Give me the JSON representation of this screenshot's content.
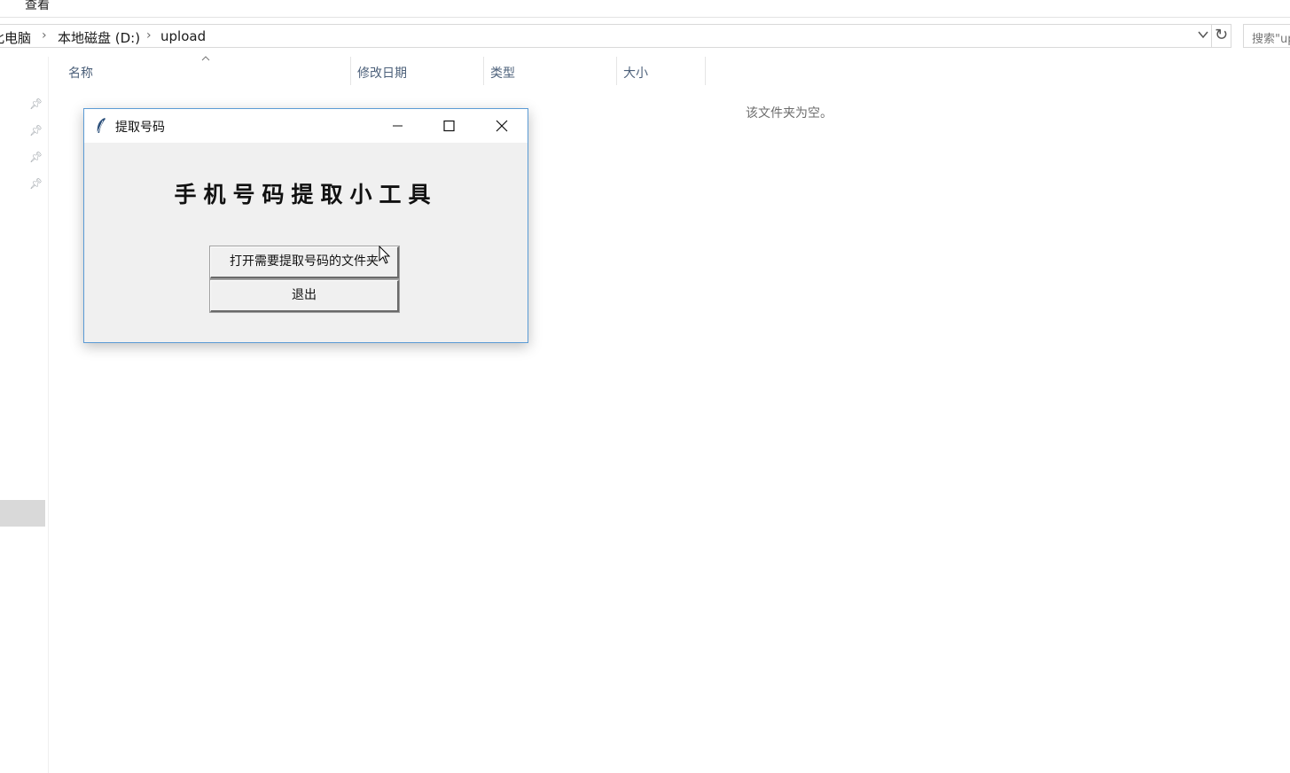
{
  "explorer": {
    "menu": {
      "view": "查看"
    },
    "breadcrumb": [
      "此电脑",
      "本地磁盘 (D:)",
      "upload"
    ],
    "search": {
      "placeholder": "搜索\"upload\""
    },
    "columns": [
      "名称",
      "修改日期",
      "类型",
      "大小"
    ],
    "empty_message": "该文件夹为空。"
  },
  "dialog": {
    "title": "提取号码",
    "heading": "手机号码提取小工具",
    "open_button": "打开需要提取号码的文件夹",
    "exit_button": "退出"
  },
  "icons": {
    "dropdown": "chevron-down-icon",
    "refresh": "refresh-icon",
    "pin": "pin-icon",
    "app": "feather-icon"
  },
  "colors": {
    "dialog_border": "#5b9bd5",
    "dialog_bg": "#f0f0f0",
    "column_header_text": "#4c607a"
  }
}
